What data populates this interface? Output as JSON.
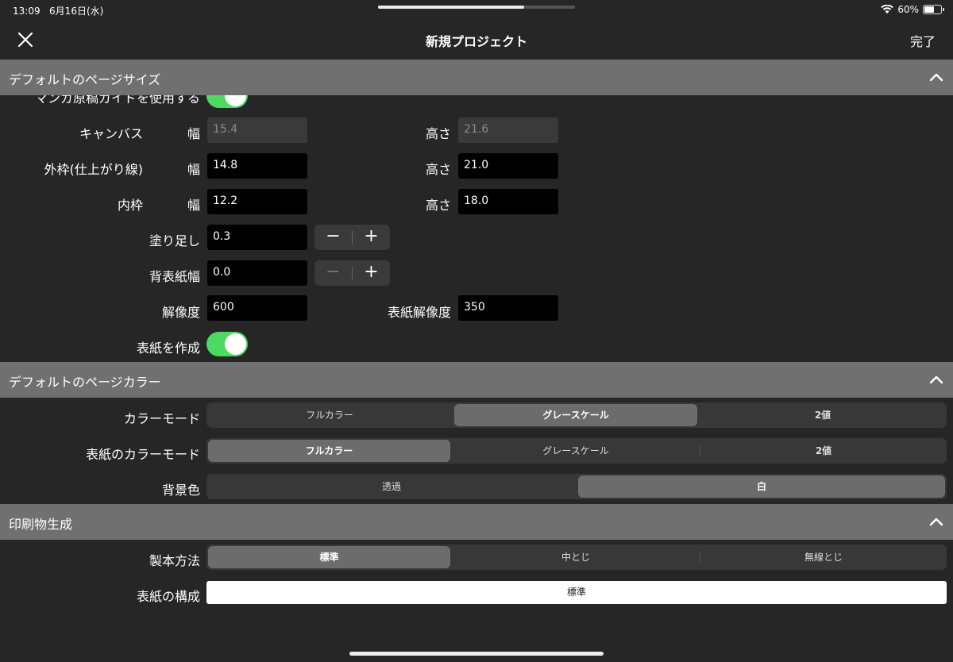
{
  "status": {
    "time": "13:09",
    "date": "6月16日(水)",
    "battery": "60%",
    "battery_level": 0.6
  },
  "nav": {
    "title": "新規プロジェクト",
    "done": "完了",
    "close_icon": "close-icon"
  },
  "sections": {
    "page_size": "デフォルトのページサイズ",
    "page_color": "デフォルトのページカラー",
    "print": "印刷物生成"
  },
  "page_size": {
    "manga_guide_label": "マンガ原稿ガイドを使用する",
    "canvas": {
      "label": "キャンバス",
      "width_label": "幅",
      "width": "15.4",
      "height_label": "高さ",
      "height": "21.6"
    },
    "outer": {
      "label": "外枠(仕上がり線)",
      "width_label": "幅",
      "width": "14.8",
      "height_label": "高さ",
      "height": "21.0"
    },
    "inner": {
      "label": "内枠",
      "width_label": "幅",
      "width": "12.2",
      "height_label": "高さ",
      "height": "18.0"
    },
    "bleed": {
      "label": "塗り足し",
      "value": "0.3"
    },
    "spine": {
      "label": "背表紙幅",
      "value": "0.0"
    },
    "resolution": {
      "label": "解像度",
      "value": "600"
    },
    "cover_resolution": {
      "label": "表紙解像度",
      "value": "350"
    },
    "create_cover": {
      "label": "表紙を作成",
      "on": true
    },
    "stepper": {
      "minus": "−",
      "plus": "+"
    }
  },
  "page_color": {
    "color_mode": {
      "label": "カラーモード",
      "options": [
        "フルカラー",
        "グレースケール",
        "2値"
      ],
      "selected": 1
    },
    "cover_color_mode": {
      "label": "表紙のカラーモード",
      "options": [
        "フルカラー",
        "グレースケール",
        "2値"
      ],
      "selected": 0
    },
    "background": {
      "label": "背景色",
      "options": [
        "透過",
        "白"
      ],
      "selected": 1
    }
  },
  "print": {
    "binding": {
      "label": "製本方法",
      "options": [
        "標準",
        "中とじ",
        "無線とじ"
      ],
      "selected": 0
    },
    "cover_structure": {
      "label": "表紙の構成",
      "value": "標準"
    }
  }
}
